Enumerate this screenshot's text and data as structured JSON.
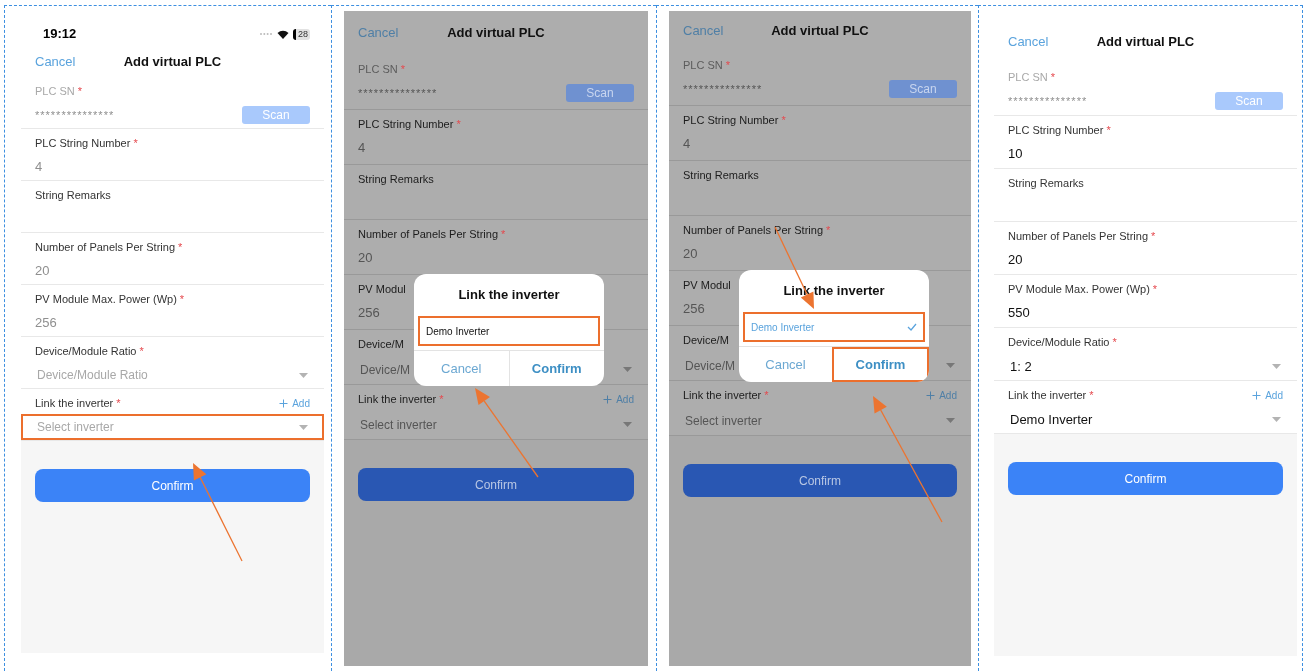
{
  "panels": [
    {
      "status_bar": {
        "time": "19:12",
        "battery": "28"
      },
      "dimmed": false,
      "nav": {
        "cancel": "Cancel",
        "title": "Add virtual PLC"
      },
      "fields": [
        {
          "kind": "scan",
          "label": "PLC SN",
          "mark": "*",
          "value": "***************",
          "button": "Scan",
          "disabled": true
        },
        {
          "kind": "text",
          "label": "PLC String Number",
          "mark": "*",
          "value": "4",
          "greyed": true
        },
        {
          "kind": "text",
          "label": "String Remarks"
        },
        {
          "kind": "text",
          "label": "Number of Panels Per String",
          "mark": "*",
          "value": "20",
          "greyed": true
        },
        {
          "kind": "text",
          "label": "PV Module Max. Power (Wp)",
          "mark": "*",
          "value": "256",
          "greyed": true
        },
        {
          "kind": "select",
          "label": "Device/Module Ratio",
          "mark": "*",
          "placeholder": "Device/Module Ratio",
          "highlighted": false
        },
        {
          "kind": "select",
          "label": "Link the inverter",
          "mark": "*",
          "action": "Add",
          "placeholder": "Select inverter",
          "highlighted": true
        }
      ],
      "confirm": {
        "label": "Confirm",
        "highlighted": false
      }
    },
    {
      "dimmed": true,
      "nav": {
        "cancel": "Cancel",
        "title": "Add virtual PLC"
      },
      "fields": [
        {
          "kind": "scan",
          "label": "PLC SN",
          "mark": "*",
          "value": "***************",
          "button": "Scan",
          "disabled": true
        },
        {
          "kind": "text",
          "label": "PLC String Number",
          "mark": "*",
          "value": "4",
          "greyed": true
        },
        {
          "kind": "text",
          "label": "String Remarks"
        },
        {
          "kind": "text",
          "label": "Number of Panels Per String",
          "mark": "*",
          "value": "20",
          "greyed": true
        },
        {
          "kind": "text",
          "label": "PV Modul",
          "value": "256",
          "greyed": true
        },
        {
          "kind": "select",
          "label": "Device/M",
          "placeholder": "Device/M",
          "highlighted": false
        },
        {
          "kind": "select",
          "label": "Link the inverter",
          "mark": "*",
          "action": "Add",
          "placeholder": "Select inverter",
          "highlighted": false
        }
      ],
      "confirm": {
        "label": "Confirm",
        "highlighted": false
      },
      "dialog": {
        "title": "Link the inverter",
        "options": [
          {
            "label": "Demo Inverter",
            "selected": false,
            "highlighted": true
          }
        ],
        "buttons": [
          {
            "kind": "cancel",
            "label": "Cancel",
            "highlighted": false
          },
          {
            "kind": "confirm",
            "label": "Confirm",
            "highlighted": false
          }
        ]
      }
    },
    {
      "dimmed": true,
      "nav": {
        "cancel": "Cancel",
        "title": "Add virtual PLC"
      },
      "fields": [
        {
          "kind": "scan",
          "label": "PLC SN",
          "mark": "*",
          "value": "***************",
          "button": "Scan",
          "disabled": true
        },
        {
          "kind": "text",
          "label": "PLC String Number",
          "mark": "*",
          "value": "4",
          "greyed": true
        },
        {
          "kind": "text",
          "label": "String Remarks"
        },
        {
          "kind": "text",
          "label": "Number of Panels Per String",
          "mark": "*",
          "value": "20",
          "greyed": true
        },
        {
          "kind": "text",
          "label": "PV Modul",
          "value": "256",
          "greyed": true
        },
        {
          "kind": "select",
          "label": "Device/M",
          "placeholder": "Device/M",
          "highlighted": false
        },
        {
          "kind": "select",
          "label": "Link the inverter",
          "mark": "*",
          "action": "Add",
          "placeholder": "Select inverter",
          "highlighted": false
        }
      ],
      "confirm": {
        "label": "Confirm",
        "highlighted": false
      },
      "dialog": {
        "title": "Link the inverter",
        "options": [
          {
            "label": "Demo Inverter",
            "selected": true,
            "highlighted": true
          }
        ],
        "buttons": [
          {
            "kind": "cancel",
            "label": "Cancel",
            "highlighted": false
          },
          {
            "kind": "confirm",
            "label": "Confirm",
            "highlighted": true
          }
        ]
      }
    },
    {
      "dimmed": false,
      "nav": {
        "cancel": "Cancel",
        "title": "Add virtual PLC"
      },
      "fields": [
        {
          "kind": "scan",
          "label": "PLC SN",
          "mark": "*",
          "value": "***************",
          "button": "Scan",
          "disabled": true
        },
        {
          "kind": "text",
          "label": "PLC String Number",
          "mark": "*",
          "value": "10",
          "greyed": false
        },
        {
          "kind": "text",
          "label": "String Remarks"
        },
        {
          "kind": "text",
          "label": "Number of Panels Per String",
          "mark": "*",
          "value": "20",
          "greyed": false
        },
        {
          "kind": "text",
          "label": "PV Module Max. Power (Wp)",
          "mark": "*",
          "value": "550",
          "greyed": false
        },
        {
          "kind": "select",
          "label": "Device/Module Ratio",
          "mark": "*",
          "value": "1: 2",
          "highlighted": false
        },
        {
          "kind": "select",
          "label": "Link the inverter",
          "mark": "*",
          "action": "Add",
          "value": "Demo Inverter",
          "highlighted": false
        }
      ],
      "confirm": {
        "label": "Confirm",
        "highlighted": false
      }
    }
  ]
}
